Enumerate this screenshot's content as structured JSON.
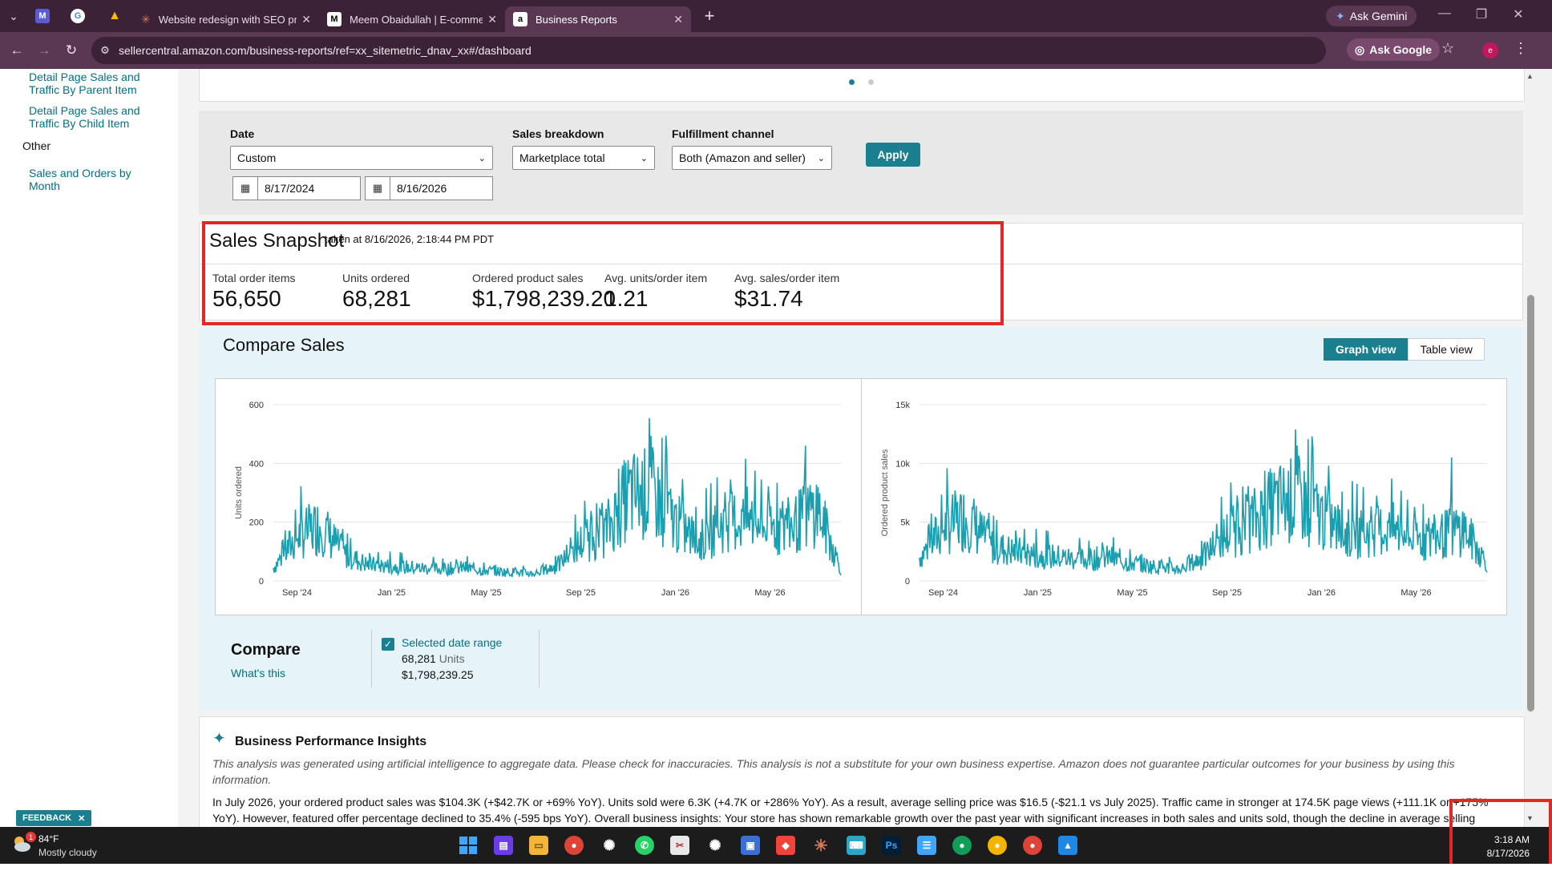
{
  "browser": {
    "tabs": [
      {
        "title": "Website redesign with SEO pre",
        "active": false
      },
      {
        "title": "Meem Obaidullah | E-commerce",
        "active": false
      },
      {
        "title": "Business Reports",
        "active": true
      }
    ],
    "ask_gemini": "Ask Gemini",
    "url": "sellercentral.amazon.com/business-reports/ref=xx_sitemetric_dnav_xx#/dashboard",
    "ask_google": "Ask Google",
    "profile_initial": "e"
  },
  "sidebar": {
    "links": [
      "Detail Page Sales and Traffic By Parent Item",
      "Detail Page Sales and Traffic By Child Item"
    ],
    "other_heading": "Other",
    "other_link": "Sales and Orders by Month"
  },
  "filters": {
    "date_label": "Date",
    "date_value": "Custom",
    "start_date": "8/17/2024",
    "end_date": "8/16/2026",
    "breakdown_label": "Sales breakdown",
    "breakdown_value": "Marketplace total",
    "channel_label": "Fulfillment channel",
    "channel_value": "Both (Amazon and seller)",
    "apply_label": "Apply"
  },
  "snapshot": {
    "title": "Sales Snapshot",
    "taken": "taken at 8/16/2026, 2:18:44 PM PDT",
    "metrics": [
      {
        "label": "Total order items",
        "value": "56,650"
      },
      {
        "label": "Units ordered",
        "value": "68,281"
      },
      {
        "label": "Ordered product sales",
        "value": "$1,798,239.20"
      },
      {
        "label": "Avg. units/order item",
        "value": "1.21"
      },
      {
        "label": "Avg. sales/order item",
        "value": "$31.74"
      }
    ]
  },
  "compare": {
    "title": "Compare Sales",
    "graph_view": "Graph view",
    "table_view": "Table view",
    "compare_label": "Compare",
    "whats_this": "What's this",
    "legend_name": "Selected date range",
    "legend_units_value": "68,281",
    "legend_units_word": "Units",
    "legend_sales": "$1,798,239.25"
  },
  "chart_data": [
    {
      "type": "line",
      "ylabel": "Units ordered",
      "ylim": [
        0,
        600
      ],
      "yticks": [
        "0",
        "200",
        "400",
        "600"
      ],
      "xticks": [
        "Sep '24",
        "Jan '25",
        "May '25",
        "Sep '25",
        "Jan '26",
        "May '26"
      ],
      "color": "#1a9fb0",
      "x": [
        "Aug '24",
        "Sep '24",
        "Oct '24",
        "Nov '24",
        "Dec '24",
        "Jan '25",
        "Feb '25",
        "Mar '25",
        "Apr '25",
        "May '25",
        "Jun '25",
        "Jul '25",
        "Aug '25",
        "Sep '25",
        "Oct '25",
        "Nov '25",
        "Dec '25",
        "Jan '26",
        "Feb '26",
        "Mar '26",
        "Apr '26",
        "May '26",
        "Jun '26",
        "Jul '26",
        "Aug '26"
      ],
      "values": [
        45,
        150,
        190,
        90,
        55,
        50,
        45,
        40,
        45,
        35,
        30,
        25,
        50,
        130,
        165,
        290,
        300,
        200,
        130,
        200,
        210,
        180,
        190,
        250,
        40
      ],
      "peaks": [
        495,
        460
      ]
    },
    {
      "type": "line",
      "ylabel": "Ordered product sales",
      "ylim": [
        0,
        15000
      ],
      "yticks": [
        "0",
        "5k",
        "10k",
        "15k"
      ],
      "xticks": [
        "Sep '24",
        "Jan '25",
        "May '25",
        "Sep '25",
        "Jan '26",
        "May '26"
      ],
      "color": "#1a9fb0",
      "x": [
        "Aug '24",
        "Sep '24",
        "Oct '24",
        "Nov '24",
        "Dec '24",
        "Jan '25",
        "Feb '25",
        "Mar '25",
        "Apr '25",
        "May '25",
        "Jun '25",
        "Jul '25",
        "Aug '25",
        "Sep '25",
        "Oct '25",
        "Nov '25",
        "Dec '25",
        "Jan '26",
        "Feb '26",
        "Mar '26",
        "Apr '26",
        "May '26",
        "Jun '26",
        "Jul '26",
        "Aug '26"
      ],
      "values": [
        2000,
        4500,
        5500,
        3000,
        2500,
        2200,
        2000,
        1800,
        2000,
        1500,
        1200,
        1000,
        2000,
        4000,
        5000,
        6500,
        7000,
        5500,
        4000,
        4200,
        4400,
        3500,
        3800,
        4500,
        1500
      ],
      "peaks": [
        12300,
        10500
      ]
    }
  ],
  "insights": {
    "title": "Business Performance Insights",
    "disclaimer": "This analysis was generated using artificial intelligence to aggregate data. Please check for inaccuracies. This analysis is not a substitute for your own business expertise. Amazon does not guarantee particular outcomes for your business by using this information.",
    "body": "In July 2026, your ordered product sales was $104.3K (+$42.7K or +69% YoY). Units sold were 6.3K (+4.7K or +286% YoY). As a result, average selling price was $16.5 (-$21.1 vs July 2025). Traffic came in stronger at 174.5K page views (+111.1K or +175% YoY). However, featured offer percentage declined to 35.4% (-595 bps YoY). Overall business insights: Your store has shown remarkable growth over the past year with significant increases in both sales and units sold, though the decline in average selling"
  },
  "feedback": "FEEDBACK",
  "taskbar": {
    "temp": "84°F",
    "weather": "Mostly cloudy",
    "weather_badge": "1",
    "time": "3:18 AM",
    "date": "8/17/2026"
  }
}
